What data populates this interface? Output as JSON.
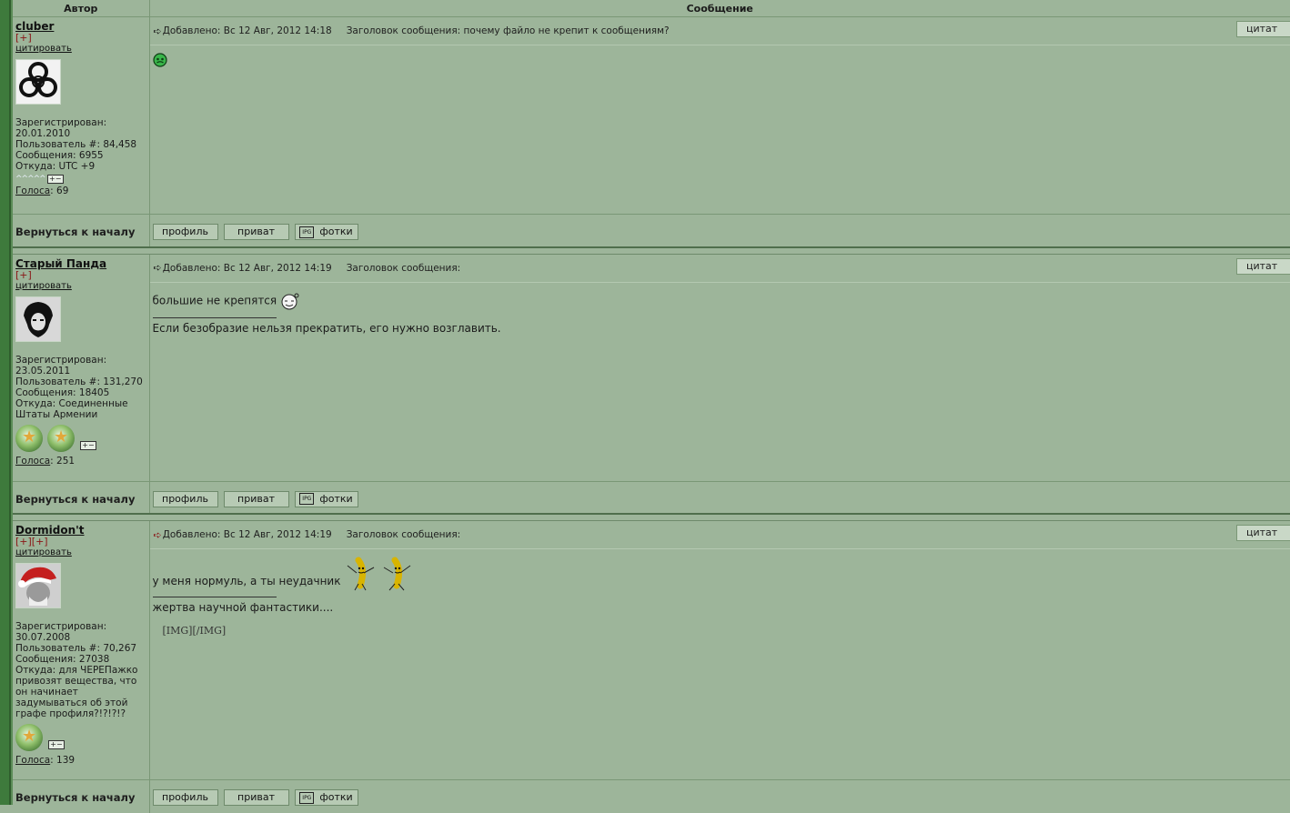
{
  "header": {
    "author_col": "Автор",
    "message_col": "Сообщение"
  },
  "posts": [
    {
      "author": "cluber",
      "plus": "[+]",
      "quote_link": "цитировать",
      "registered_label": "Зарегистрирован:",
      "registered": "20.01.2010",
      "user_no": "Пользователь #: 84,458",
      "messages": "Сообщения: 6955",
      "from": "Откуда: UTC +9",
      "votes_label": "Голоса",
      "votes": ": 69",
      "added": "Добавлено: Вс 12 Авг, 2012 14:18",
      "subject": "Заголовок сообщения: почему файло не крепит к сообщениям?",
      "quote_btn": "цитат",
      "body": "",
      "signature": ""
    },
    {
      "author": "Старый Панда",
      "plus": "[+]",
      "quote_link": "цитировать",
      "registered_label": "Зарегистрирован:",
      "registered": "23.05.2011",
      "user_no": "Пользователь #: 131,270",
      "messages": "Сообщения: 18405",
      "from": "Откуда: Соединенные Штаты Армении",
      "votes_label": "Голоса",
      "votes": ": 251",
      "added": "Добавлено: Вс 12 Авг, 2012 14:19",
      "subject": "Заголовок сообщения:",
      "quote_btn": "цитат",
      "body": "большие не крепятся",
      "signature": "Если безобразие нельзя прекратить, его нужно возглавить."
    },
    {
      "author": "Dormidon't",
      "plus": "[+][+]",
      "quote_link": "цитировать",
      "registered_label": "Зарегистрирован:",
      "registered": "30.07.2008",
      "user_no": "Пользователь #: 70,267",
      "messages": "Сообщения: 27038",
      "from": "Откуда: для ЧЕРЕПажко привозят вещества, что он начинает задумываться об этой графе профиля?!?!?!?",
      "votes_label": "Голоса",
      "votes": ": 139",
      "added": "Добавлено: Вс 12 Авг, 2012 14:19",
      "subject": "Заголовок сообщения:",
      "quote_btn": "цитат",
      "body": "у меня нормуль, а ты неудачник",
      "signature": "жертва научной фантастики....",
      "extra": "[IMG][/IMG]"
    }
  ],
  "bottom": {
    "back_to_top": "Вернуться к началу",
    "profile_btn": "профиль",
    "private_btn": "приват",
    "photos_btn": "фотки"
  }
}
